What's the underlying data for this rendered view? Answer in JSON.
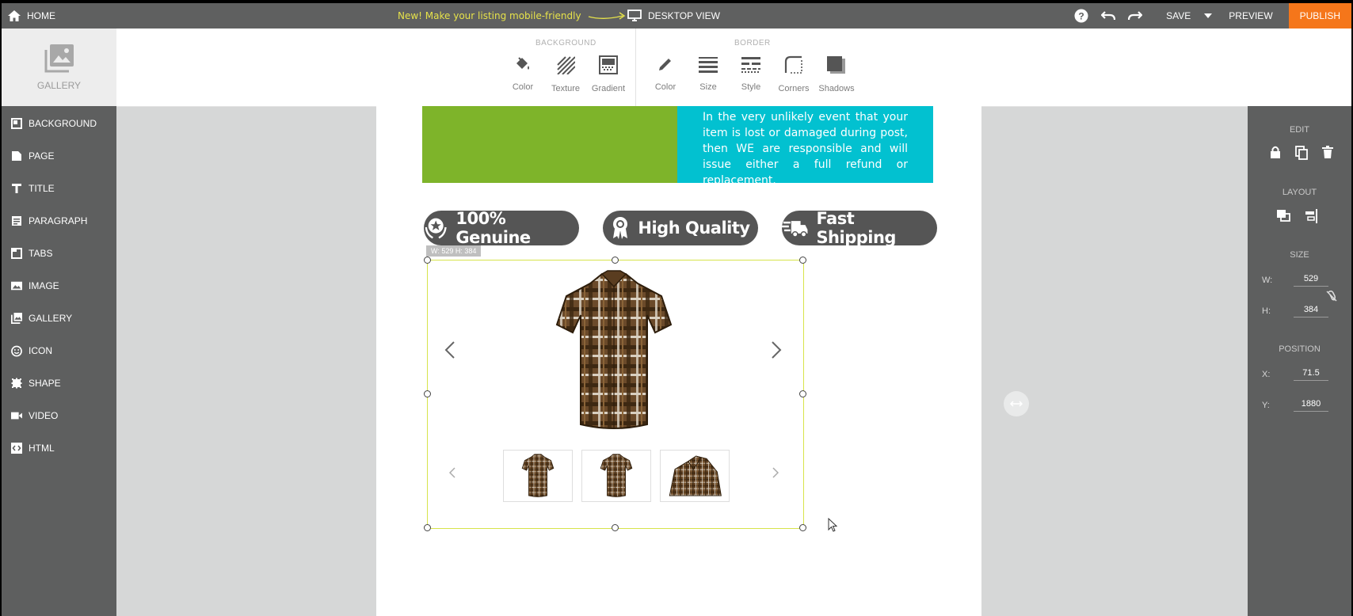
{
  "topbar": {
    "home_label": "HOME",
    "promo_text": "New! Make your listing mobile-friendly",
    "view_label": "DESKTOP VIEW",
    "save_label": "SAVE",
    "preview_label": "PREVIEW",
    "publish_label": "PUBLISH"
  },
  "toolbar": {
    "gallery_label": "GALLERY",
    "background_title": "BACKGROUND",
    "border_title": "BORDER",
    "background_tools": [
      "Color",
      "Texture",
      "Gradient"
    ],
    "border_tools": [
      "Color",
      "Size",
      "Style",
      "Corners",
      "Shadows"
    ]
  },
  "sidebar": {
    "items": [
      "BACKGROUND",
      "PAGE",
      "TITLE",
      "PARAGRAPH",
      "TABS",
      "IMAGE",
      "GALLERY",
      "ICON",
      "SHAPE",
      "VIDEO",
      "HTML"
    ]
  },
  "right_panel": {
    "edit_title": "EDIT",
    "layout_title": "LAYOUT",
    "size_title": "SIZE",
    "position_title": "POSITION",
    "w_label": "W:",
    "w_value": "529",
    "h_label": "H:",
    "h_value": "384",
    "x_label": "X:",
    "x_value": "71.5",
    "y_label": "Y:",
    "y_value": "1880"
  },
  "canvas": {
    "info_text": "In the very unlikely event that your item is lost or damaged during post, then WE are responsible and will issue either a full refund or replacement.",
    "badges": [
      "100% Genuine",
      "High Quality",
      "Fast Shipping"
    ],
    "dim_tag": "W: 529   H: 384"
  },
  "colors": {
    "accent": "#f5761a",
    "green_block": "#7eb42a",
    "cyan_block": "#02c1d0",
    "selection": "#d7e34a"
  }
}
